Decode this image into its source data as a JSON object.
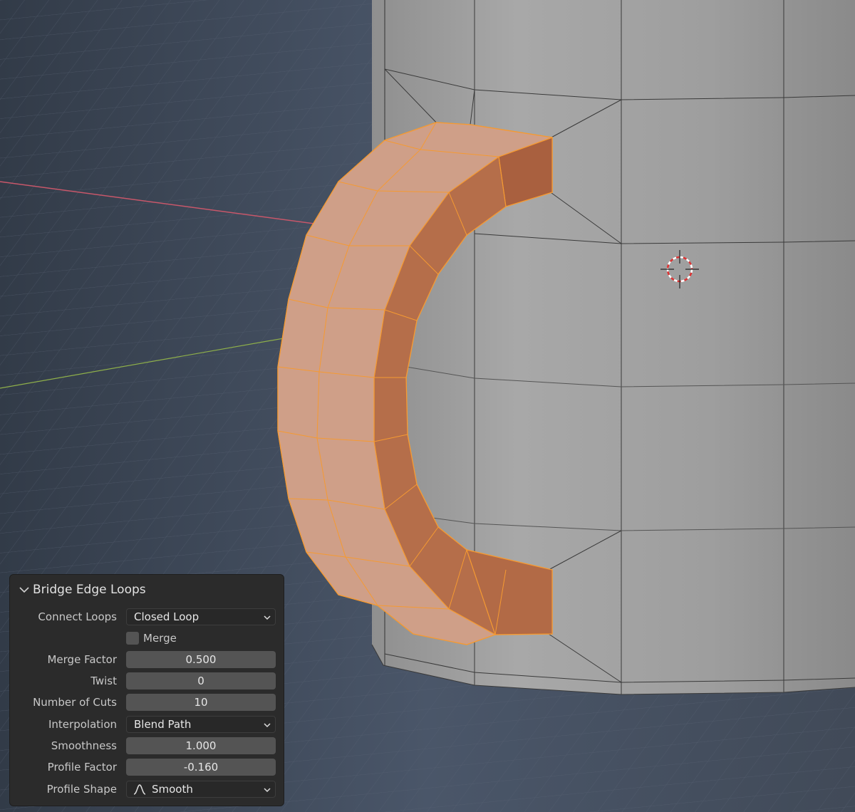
{
  "operator_panel": {
    "title": "Bridge Edge Loops",
    "connect_loops": {
      "label": "Connect Loops",
      "value": "Closed Loop"
    },
    "merge": {
      "label": "Merge",
      "checked": false
    },
    "merge_factor": {
      "label": "Merge Factor",
      "value": "0.500"
    },
    "twist": {
      "label": "Twist",
      "value": "0"
    },
    "number_of_cuts": {
      "label": "Number of Cuts",
      "value": "10"
    },
    "interpolation": {
      "label": "Interpolation",
      "value": "Blend Path"
    },
    "smoothness": {
      "label": "Smoothness",
      "value": "1.000"
    },
    "profile_factor": {
      "label": "Profile Factor",
      "value": "-0.160"
    },
    "profile_shape": {
      "label": "Profile Shape",
      "value": "Smooth",
      "icon": "smooth-profile-icon"
    }
  },
  "colors": {
    "viewport_bg": "#3a4352",
    "mesh_gray": "#9d9d9d",
    "selected_face": "#c98c6c",
    "selected_edge": "#f59a32",
    "x_axis": "#c8576a",
    "y_axis": "#8fb04a",
    "panel_bg": "#2b2b2b"
  }
}
